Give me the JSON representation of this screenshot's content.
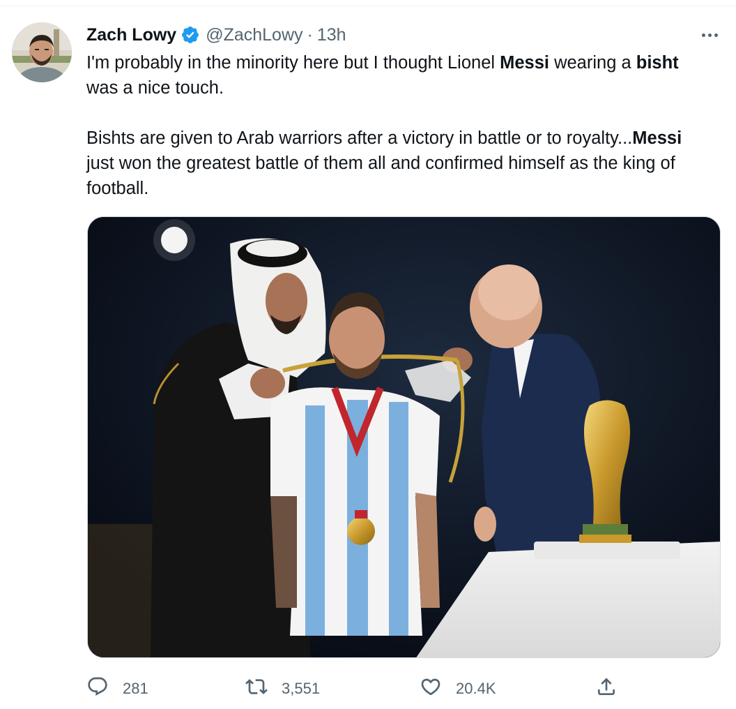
{
  "tweet": {
    "author_name": "Zach Lowy",
    "handle": "@ZachLowy",
    "separator": "·",
    "time": "13h",
    "text": {
      "p1_a": "I'm probably in the minority here but I thought Lionel ",
      "p1_b": "Messi",
      "p1_c": " wearing a ",
      "p1_d": "bisht",
      "p1_e": " was a nice touch.",
      "p2_a": "Bishts are given to Arab warriors after a victory in battle or to royalty...",
      "p2_b": "Messi",
      "p2_c": " just won the greatest battle of them all and confirmed himself as the king of football."
    },
    "stats": {
      "replies": "281",
      "retweets": "3,551",
      "likes": "20.4K"
    }
  },
  "icons": {
    "avatar": "user-avatar",
    "verified": "verified-badge-icon",
    "more": "more-options-icon",
    "reply": "reply-icon",
    "retweet": "retweet-icon",
    "like": "heart-icon",
    "share": "share-icon"
  },
  "colors": {
    "text": "#0f1419",
    "secondary": "#536471",
    "verified": "#1d9bf0",
    "border": "#cfd9de"
  }
}
